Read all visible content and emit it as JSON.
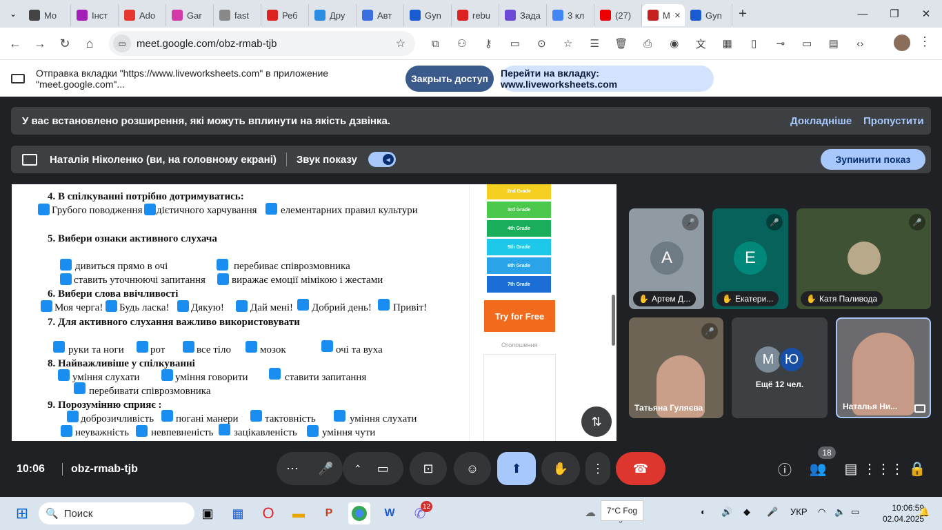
{
  "browser": {
    "tabs": [
      {
        "label": "Mo",
        "color": "#444"
      },
      {
        "label": "Інст",
        "color": "#a31fb8"
      },
      {
        "label": "Ado",
        "color": "#e5372f"
      },
      {
        "label": "Gar",
        "color": "#d33ca8"
      },
      {
        "label": "fast",
        "color": "#888"
      },
      {
        "label": "Реб",
        "color": "#d22"
      },
      {
        "label": "Дру",
        "color": "#2a8be0"
      },
      {
        "label": "Авт",
        "color": "#3b6fe0"
      },
      {
        "label": "Gyn",
        "color": "#1a5bd1"
      },
      {
        "label": "rebu",
        "color": "#d22"
      },
      {
        "label": "Зада",
        "color": "#6b4bd6"
      },
      {
        "label": "3 кл",
        "color": "#4285f4"
      },
      {
        "label": "(27)",
        "color": "#e00"
      },
      {
        "label": "М",
        "color": "#c5221f"
      },
      {
        "label": "Gyn",
        "color": "#1a5bd1"
      }
    ],
    "url": "meet.google.com/obz-rmab-tjb"
  },
  "share_bar": {
    "message": "Отправка вкладки \"https://www.liveworksheets.com\" в приложение \"meet.google.com\"...",
    "close_label": "Закрыть доступ",
    "go_label": "Перейти на вкладку: www.liveworksheets.com"
  },
  "meet": {
    "warning": "У вас встановлено розширення, які можуть вплинути на якість дзвінка.",
    "learn_more": "Докладніше",
    "skip": "Пропустити",
    "presenter": "Наталія Ніколенко (ви, на головному екрані)",
    "sound_label": "Звук показу",
    "stop_label": "Зупинити показ",
    "time": "10:06",
    "meeting_code": "obz-rmab-tjb",
    "participants_count": "18"
  },
  "worksheet": {
    "q4": "4. В спілкуванні потрібно дотримуватись:",
    "q4o": [
      "Грубого поводження",
      "дієтичного харчування",
      "елементарних правил культури"
    ],
    "q5": "5. Вибери ознаки активного слухача",
    "q5o": [
      "дивиться прямо в очі",
      "перебиває співрозмовника",
      "ставить уточнюючі запитання",
      "виражає емоції мімікою і жестами"
    ],
    "q6": "6. Вибери слова ввічливості",
    "q6o": [
      "Моя черга!",
      "Будь ласка!",
      "Дякую!",
      "Дай мені!",
      "Добрий день!",
      "Привіт!"
    ],
    "q7": "7. Для активного слухання важливо використовувати",
    "q7o": [
      "руки та ноги",
      "рот",
      "все тіло",
      "мозок",
      "очі та вуха"
    ],
    "q8": "8. Найважливіше у спілкуванні",
    "q8o": [
      "уміння слухати",
      "уміння говорити",
      "ставити запитання",
      "перебивати співрозмовника"
    ],
    "q9": "9. Порозумінню сприяє :",
    "q9o": [
      "доброзичливість",
      "погані манери",
      "тактовність",
      "уміння слухати",
      "неуважність",
      "невпевненість",
      "зацікавленість",
      "уміння чути"
    ]
  },
  "ad": {
    "grades": [
      "2nd Grade",
      "3rd Grade",
      "4th Grade",
      "5th Grade",
      "6th Grade",
      "7th Grade"
    ],
    "grade_colors": [
      "#f5d020",
      "#4cc94c",
      "#1aae5a",
      "#1ec8e8",
      "#2aa3e8",
      "#1a6ed6"
    ],
    "try_label": "Try for Free",
    "ad_label": "Оголошення"
  },
  "participants": [
    {
      "name": "Артем Д...",
      "initial": "А",
      "color": "#6e7a84"
    },
    {
      "name": "Екатери...",
      "initial": "Е",
      "color": "#00897b"
    },
    {
      "name": "Катя Паливода"
    },
    {
      "name": "Татьяна Гуляєва"
    },
    {
      "more": "Ещё 12 чел.",
      "initials": [
        "М",
        "Ю"
      ]
    },
    {
      "name": "Наталья Ни..."
    }
  ],
  "taskbar": {
    "search": "Поиск",
    "weather": "7°C Fog",
    "weather_sub": "Fog",
    "lang": "УКР",
    "time": "10:06:59",
    "date": "02.04.2025",
    "viber_badge": "12"
  }
}
